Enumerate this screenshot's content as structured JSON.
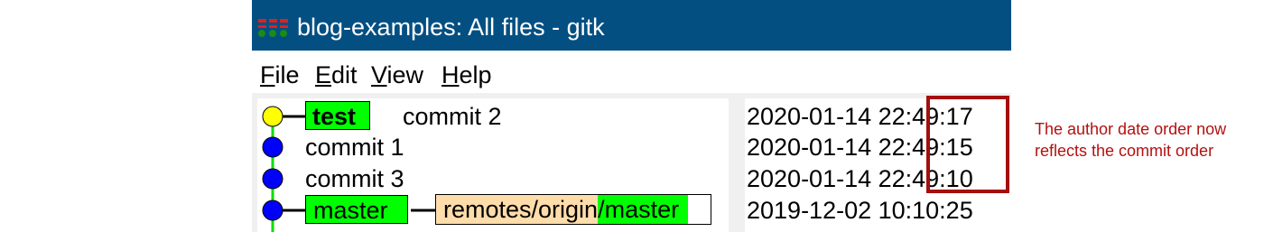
{
  "window": {
    "title": "blog-examples: All files - gitk",
    "icon": "gitk-icon",
    "colors": {
      "titlebar": "#034f82",
      "branch_tag": "#00ff00",
      "remote_tag": "#ffddaa",
      "highlight": "#a50e0e"
    }
  },
  "menu": [
    {
      "underline": "F",
      "rest": "ile"
    },
    {
      "underline": "E",
      "rest": "dit"
    },
    {
      "underline": "V",
      "rest": "iew"
    },
    {
      "underline": "H",
      "rest": "elp"
    }
  ],
  "commits": [
    {
      "message": "commit 2",
      "ref": "test",
      "date": "2020-01-14 22:49:17",
      "node_color": "#ffff00"
    },
    {
      "message": "commit 1",
      "date": "2020-01-14 22:49:15",
      "node_color": "#0000ff"
    },
    {
      "message": "commit 3",
      "date": "2020-01-14 22:49:10",
      "node_color": "#0000ff"
    },
    {
      "ref": "master",
      "remote_ref_prefix": "remotes/origin",
      "remote_ref_branch": "/master",
      "date": "2019-12-02 10:10:25",
      "node_color": "#0000ff"
    }
  ],
  "annotation": "The author date order now reflects the commit order"
}
